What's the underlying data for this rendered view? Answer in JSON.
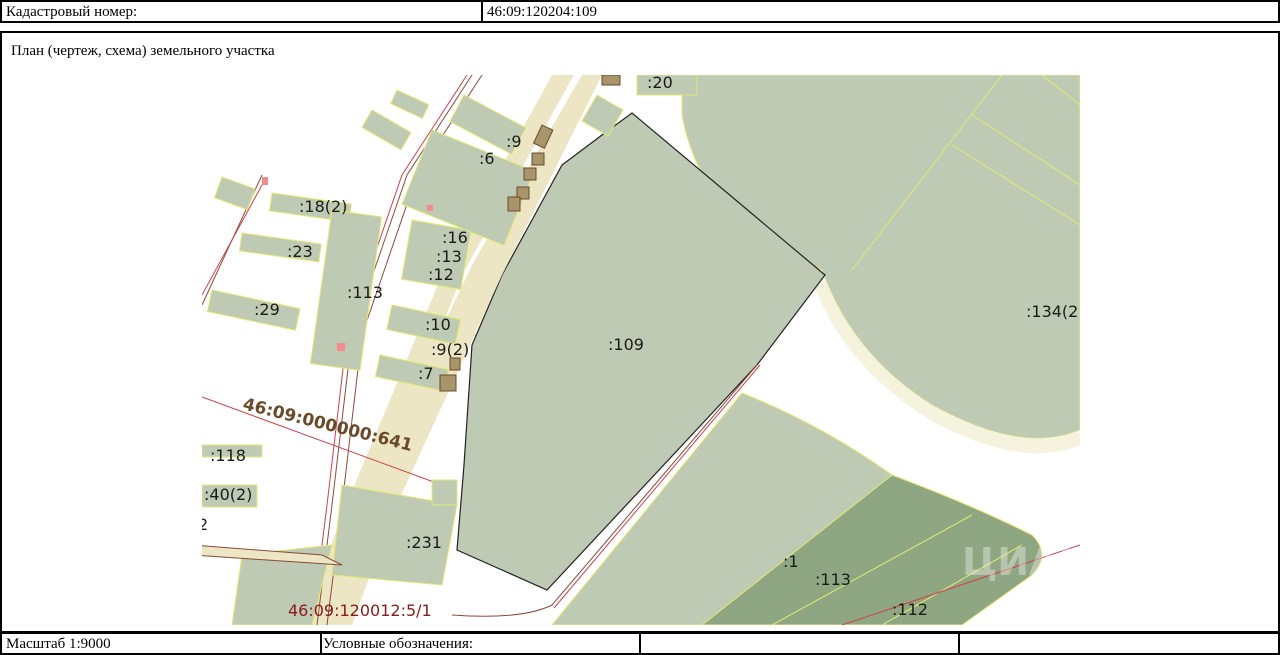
{
  "header": {
    "cadastral_label": "Кадастровый номер:",
    "cadastral_value": "46:09:120204:109"
  },
  "plan": {
    "title": "План (чертеж, схема) земельного участка"
  },
  "footer": {
    "scale": "Масштаб 1:9000",
    "legend_label": "Условные обозначения:"
  },
  "map": {
    "main_parcel": ":109",
    "labels": [
      ":20",
      ":9",
      ":6",
      ":18(2)",
      ":23",
      ":16",
      ":13",
      ":12",
      ":113",
      ":29",
      ":10",
      ":9(2)",
      ":7",
      ":118",
      ":40(2)",
      ":231",
      ":134(2",
      ":1",
      ":113",
      ":112",
      "2"
    ],
    "quarter_label": "46:09:000000:641",
    "road_label": "46:09:120012:5/1",
    "watermark": "ЦИАН"
  },
  "colors": {
    "parcel_fill": "#bfcab4",
    "dark_parcel_fill": "#8fa682",
    "road_fill": "#ece6c4",
    "boundary_yellow": "#e3ea70",
    "red_line": "#d0404a",
    "brown_line": "#8a4b3a"
  }
}
